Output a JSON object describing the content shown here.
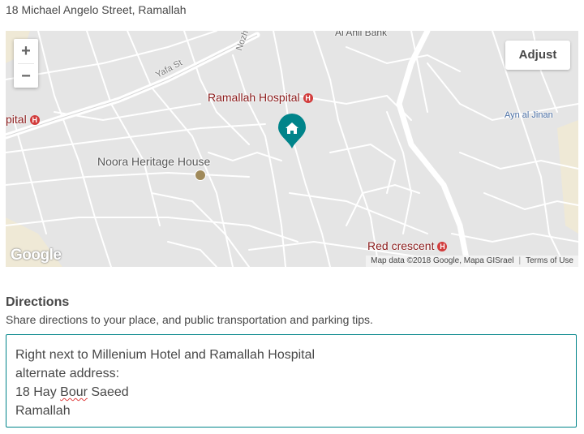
{
  "address": "18 Michael Angelo Street, Ramallah",
  "map": {
    "zoom_in": "+",
    "zoom_out": "−",
    "adjust_label": "Adjust",
    "labels": {
      "al_ahli_bank": "Al Ahli Bank",
      "nozha_st": "Nozha St",
      "yafa_st": "Yafa St",
      "ramallah_hospital": "Ramallah Hospital",
      "hospital_left": "pital",
      "ayn_al_jinan": "Ayn al Jinan",
      "noora_heritage_house": "Noora Heritage House",
      "red_crescent": "Red crescent"
    },
    "hospital_glyph": "H",
    "google_logo": "Google",
    "attribution": "Map data ©2018 Google, Mapa GISrael",
    "terms": "Terms of Use",
    "accent_color": "#00848A"
  },
  "directions": {
    "title": "Directions",
    "subtitle": "Share directions to your place, and public transportation and parking tips.",
    "text_lines": [
      "Right next to Millenium Hotel and Ramallah Hospital",
      "alternate address:",
      "18 Hay ",
      "Bour",
      " Saeed",
      "Ramallah"
    ]
  }
}
